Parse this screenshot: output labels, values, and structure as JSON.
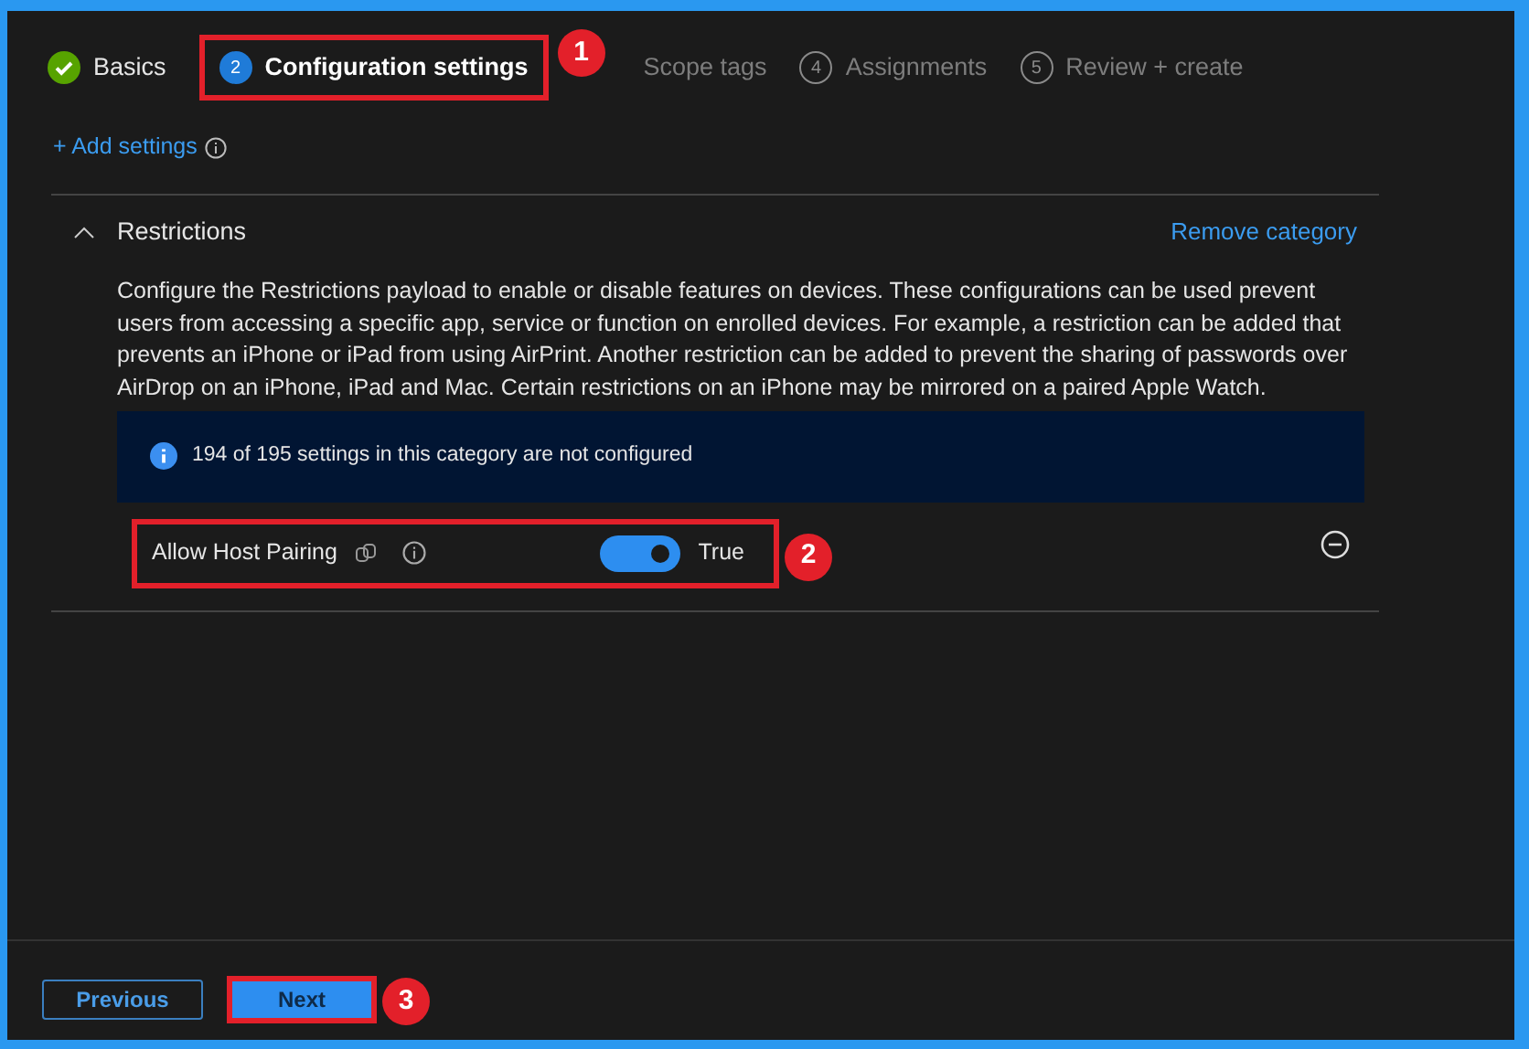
{
  "steps": [
    {
      "kind": "done",
      "label": "Basics",
      "highlighted": false
    },
    {
      "kind": "current",
      "number": "2",
      "label": "Configuration settings",
      "highlighted": true,
      "callout": "1"
    },
    {
      "kind": "pending",
      "label": "Scope tags",
      "highlighted": false
    },
    {
      "kind": "pending",
      "number": "4",
      "label": "Assignments",
      "highlighted": false
    },
    {
      "kind": "pending",
      "number": "5",
      "label": "Review + create",
      "highlighted": false
    }
  ],
  "add_settings": "+ Add settings",
  "category": {
    "title": "Restrictions",
    "expanded": true,
    "remove_link": "Remove category",
    "description": "Configure the Restrictions payload to enable or disable features on devices. These configurations can be used prevent users from accessing a specific app, service or function on enrolled devices. For example, a restriction can be added that prevents an iPhone or iPad from using AirPrint. Another restriction can be added to prevent the sharing of passwords over AirDrop on an iPhone, iPad and Mac. Certain restrictions on an iPhone may be mirrored on a paired Apple Watch.",
    "info": "194 of 195 settings in this category are not configured",
    "settings": [
      {
        "label": "Allow Host Pairing",
        "on": true,
        "value": "True",
        "highlighted": true,
        "callout": "2"
      }
    ]
  },
  "footer": {
    "buttons": [
      {
        "label": "Previous",
        "kind": "secondary",
        "highlighted": false
      },
      {
        "label": "Next",
        "kind": "primary",
        "highlighted": true,
        "callout": "3"
      }
    ]
  }
}
